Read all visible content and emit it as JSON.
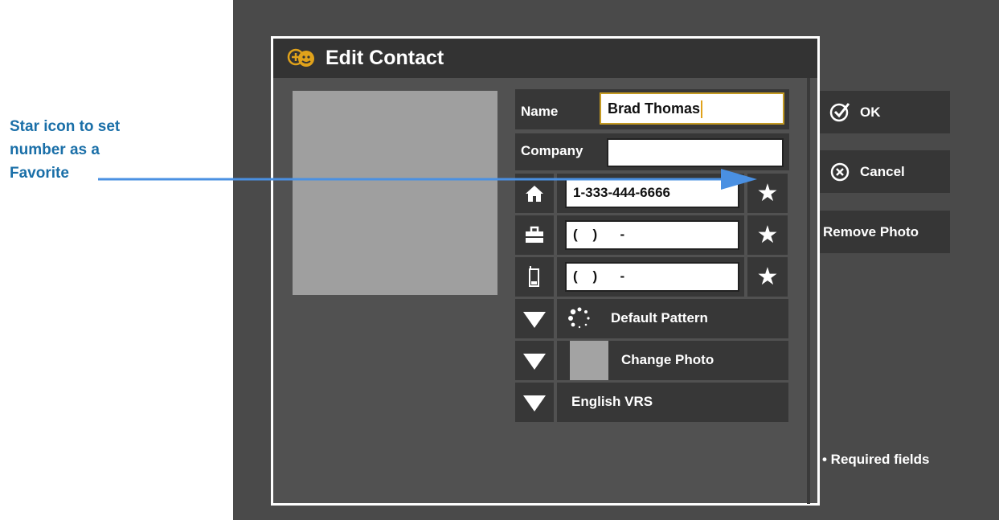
{
  "annotation": {
    "lines": [
      "Star icon to set",
      "number as a",
      "Favorite"
    ]
  },
  "dialog": {
    "title": "Edit Contact",
    "fields": {
      "name_label": "Name",
      "name_value": "Brad Thomas",
      "company_label": "Company",
      "company_value": ""
    },
    "phones": [
      {
        "icon": "home-icon",
        "value": "1-333-444-6666"
      },
      {
        "icon": "briefcase-icon",
        "value": "(    )      -"
      },
      {
        "icon": "mobile-phone-icon",
        "value": "(    )      -"
      }
    ],
    "options": {
      "ring_pattern": "Default Pattern",
      "photo": "Change Photo",
      "vrs": "English VRS"
    },
    "buttons": {
      "ok": "OK",
      "cancel": "Cancel",
      "remove_photo": "Remove Photo"
    },
    "required_note": "• Required fields"
  },
  "colors": {
    "accent": "#c49a22",
    "callout": "#1a6fa8",
    "arrow": "#4a90e2"
  }
}
